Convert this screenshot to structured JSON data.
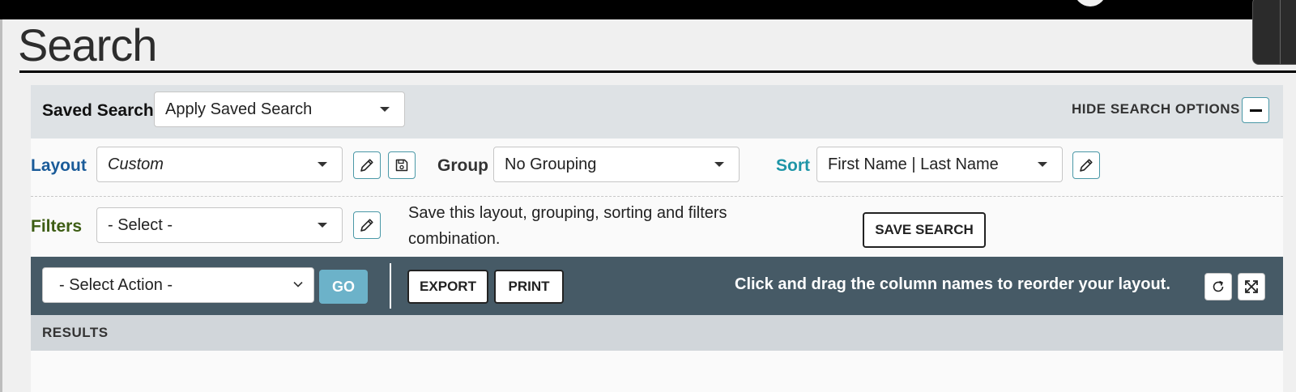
{
  "page": {
    "title": "Search"
  },
  "saved_search": {
    "label": "Saved Search",
    "select_value": "Apply Saved Search",
    "hide_options_label": "HIDE SEARCH OPTIONS"
  },
  "layout": {
    "label": "Layout",
    "value": "Custom"
  },
  "group": {
    "label": "Group",
    "value": "No Grouping"
  },
  "sort": {
    "label": "Sort",
    "value": "First Name | Last Name"
  },
  "filters": {
    "label": "Filters",
    "value": "- Select -",
    "save_note": "Save this layout, grouping, sorting and filters combination.",
    "save_button": "SAVE SEARCH"
  },
  "actions": {
    "select_value": "- Select Action -",
    "go_button": "GO",
    "export_button": "EXPORT",
    "print_button": "PRINT",
    "drag_note": "Click and drag the column names to reorder your layout."
  },
  "results": {
    "label": "RESULTS"
  },
  "colors": {
    "layout_label": "#1a5b99",
    "sort_label": "#1e95a7",
    "filters_label": "#3d5d14",
    "action_bar": "#465a66",
    "go_button": "#6cb2c9",
    "icon_border": "#4a98a7"
  },
  "icons": {
    "hide_options": "minus-icon",
    "layout_edit": "pencil-icon",
    "layout_save": "save-icon",
    "sort_edit": "pencil-icon",
    "filters_edit": "pencil-icon",
    "refresh": "refresh-icon",
    "expand": "expand-icon"
  }
}
